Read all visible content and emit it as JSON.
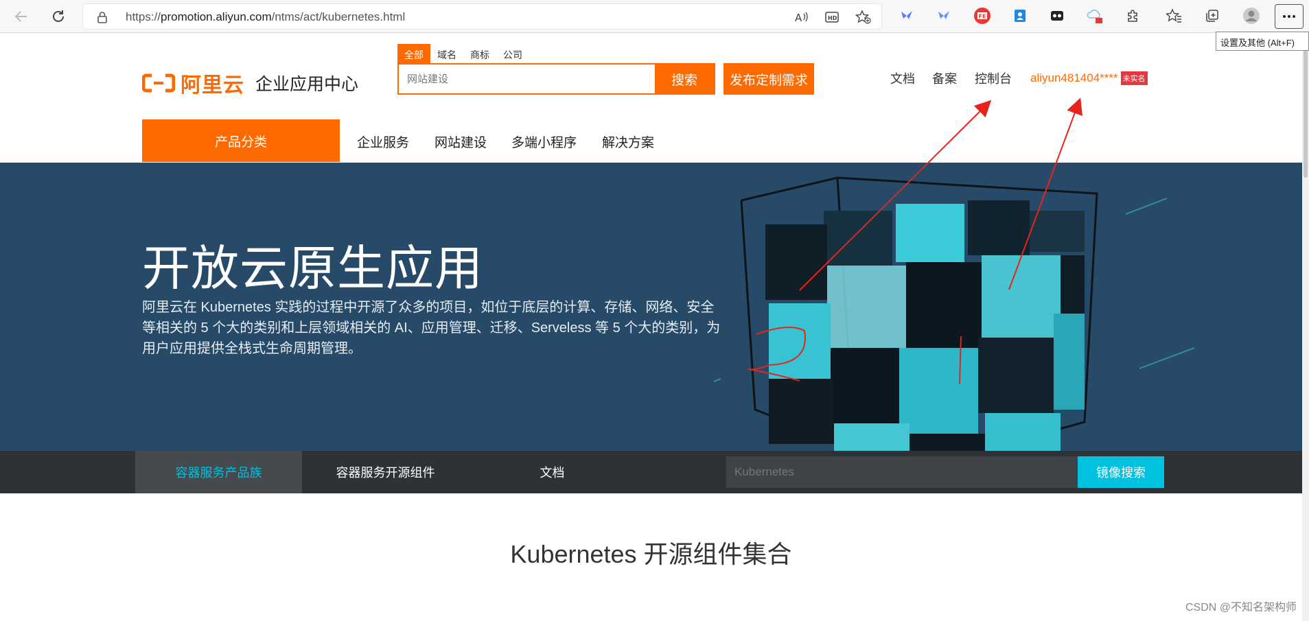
{
  "browser": {
    "url_prefix": "https://",
    "url_host": "promotion.aliyun.com",
    "url_path": "/ntms/act/kubernetes.html",
    "tooltip": "设置及其他 (Alt+F)"
  },
  "header": {
    "brand": "阿里云",
    "subtitle": "企业应用中心",
    "search_tabs": [
      "全部",
      "域名",
      "商标",
      "公司"
    ],
    "search_placeholder": "网站建设",
    "search_button": "搜索",
    "publish_button": "发布定制需求",
    "links": [
      "文档",
      "备案",
      "控制台"
    ],
    "user_name": "aliyun481404****",
    "user_badge": "未实名"
  },
  "nav": {
    "category_button": "产品分类",
    "items": [
      "企业服务",
      "网站建设",
      "多端小程序",
      "解决方案"
    ]
  },
  "hero": {
    "title": "开放云原生应用",
    "description": "阿里云在 Kubernetes 实践的过程中开源了众多的项目，如位于底层的计算、存储、网络、安全等相关的 5 个大的类别和上层领域相关的 AI、应用管理、迁移、Serveless 等 5 个大的类别，为用户应用提供全栈式生命周期管理。"
  },
  "subnav": {
    "tabs": [
      "容器服务产品族",
      "容器服务开源组件",
      "文档"
    ],
    "search_placeholder": "Kubernetes",
    "search_button": "镜像搜索"
  },
  "section": {
    "title": "Kubernetes 开源组件集合"
  },
  "watermark": "CSDN @不知名架构师",
  "colors": {
    "brand_orange": "#ff6a00",
    "hero_bg": "#264a67",
    "subbar_bg": "#2f3235",
    "accent_cyan": "#00c1de",
    "annotation_red": "#e8231c"
  }
}
